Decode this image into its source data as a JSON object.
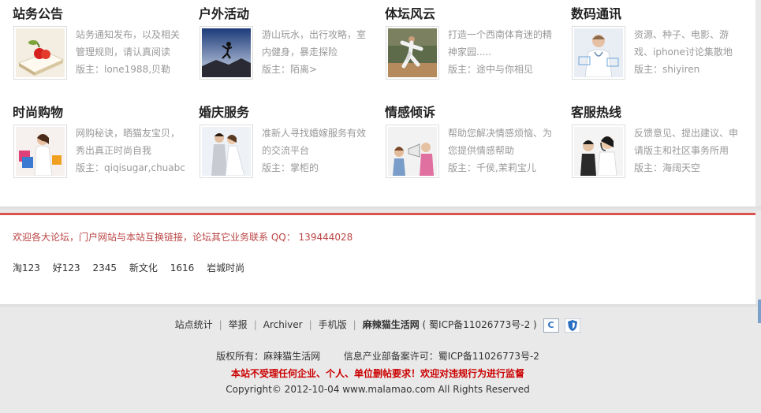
{
  "forums": [
    {
      "title": "站务公告",
      "desc": [
        "站务通知发布，以及相关",
        "管理规则，请认真阅读"
      ],
      "moderator": "版主：lone1988,贝勒",
      "icon": "book-apple-icon"
    },
    {
      "title": "户外活动",
      "desc": [
        "游山玩水，出行攻略，室",
        "内健身，暴走探险"
      ],
      "moderator": "版主：陌离>",
      "icon": "jumping-person-icon"
    },
    {
      "title": "体坛风云",
      "desc": [
        "打造一个西南体育迷的精",
        "神家园....."
      ],
      "moderator": "版主：途中与你相见",
      "icon": "baseball-player-icon"
    },
    {
      "title": "数码通讯",
      "desc": [
        "资源、种子、电影、游",
        "戏、iphone讨论集散地"
      ],
      "moderator": "版主：shiyiren",
      "icon": "doctor-screen-icon"
    },
    {
      "title": "时尚购物",
      "desc": [
        "网购秘诀，晒猫友宝贝，",
        "秀出真正时尚自我"
      ],
      "moderator": "版主：qiqisugar,chuabc",
      "icon": "shopping-woman-icon"
    },
    {
      "title": "婚庆服务",
      "desc": [
        "准新人寻找婚嫁服务有效",
        "的交流平台"
      ],
      "moderator": "版主：掌柜的",
      "icon": "wedding-couple-icon"
    },
    {
      "title": "情感倾诉",
      "desc": [
        "帮助您解决情感烦恼、为",
        "您提供情感帮助"
      ],
      "moderator": "版主：千侯,茉莉宝儿",
      "icon": "megaphone-people-icon"
    },
    {
      "title": "客服热线",
      "desc": [
        "反馈意见、提出建议、申",
        "请版主和社区事务所用"
      ],
      "moderator": "版主：海阔天空",
      "icon": "headset-operators-icon"
    }
  ],
  "links": {
    "notice": "欢迎各大论坛，门户网站与本站互换链接，论坛其它业务联系 QQ：",
    "qq": "139444028",
    "items": [
      "淘123",
      "好123",
      "2345",
      "新文化",
      "1616",
      "岩城时尚"
    ]
  },
  "footer": {
    "nav": [
      "站点统计",
      "举报",
      "Archiver",
      "手机版"
    ],
    "site_name": "麻辣猫生活网",
    "icp": "( 蜀ICP备11026773号-2 )",
    "badge_label": "C",
    "copyright_owner": "版权所有：麻辣猫生活网",
    "license": "信息产业部备案许可：蜀ICP备11026773号-2",
    "warning": "本站不受理任何企业、个人、单位删帖要求！欢迎对违规行为进行监督",
    "copyright": "Copyright© 2012-10-04 www.malamao.com All Rights Reserved"
  },
  "colors": {
    "accent_red": "#d9534f",
    "warning_red": "#cc0000",
    "link_red": "#bb4444"
  }
}
